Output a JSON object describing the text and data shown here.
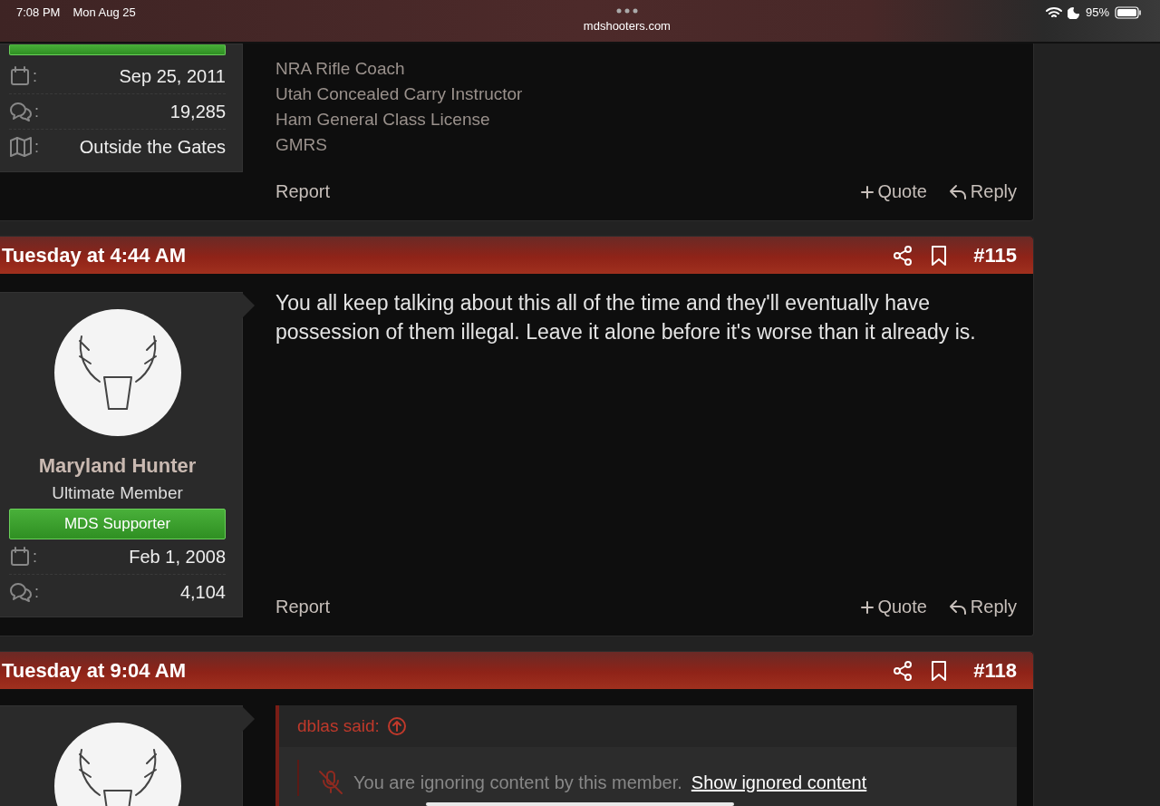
{
  "status_bar": {
    "time": "7:08 PM",
    "date": "Mon Aug 25",
    "url": "mdshooters.com",
    "battery": "95%"
  },
  "posts": [
    {
      "user": {
        "stats": [
          {
            "kind": "joined",
            "sep": ":",
            "value": "Sep 25, 2011"
          },
          {
            "kind": "messages",
            "sep": ":",
            "value": "19,285"
          },
          {
            "kind": "location",
            "sep": ":",
            "value": "Outside the Gates"
          }
        ]
      },
      "signature": [
        "NRA Rifle Coach",
        "Utah Concealed Carry Instructor",
        "Ham General Class License",
        "GMRS"
      ],
      "actions": {
        "report": "Report",
        "quote": "Quote",
        "reply": "Reply"
      }
    },
    {
      "date": "Tuesday at 4:44 AM",
      "number": "#115",
      "user": {
        "name": "Maryland Hunter",
        "title": "Ultimate Member",
        "banner": "MDS Supporter",
        "stats": [
          {
            "kind": "joined",
            "sep": ":",
            "value": "Feb 1, 2008"
          },
          {
            "kind": "messages",
            "sep": ":",
            "value": "4,104"
          }
        ]
      },
      "message": "You all keep talking about this all of the time and they'll eventually have possession of them illegal. Leave it alone before it's worse than it already is.",
      "actions": {
        "report": "Report",
        "quote": "Quote",
        "reply": "Reply"
      }
    },
    {
      "date": "Tuesday at 9:04 AM",
      "number": "#118",
      "quote": {
        "author": "dblas said:",
        "ignored": "You are ignoring content by this member.",
        "link": "Show ignored content"
      }
    }
  ]
}
